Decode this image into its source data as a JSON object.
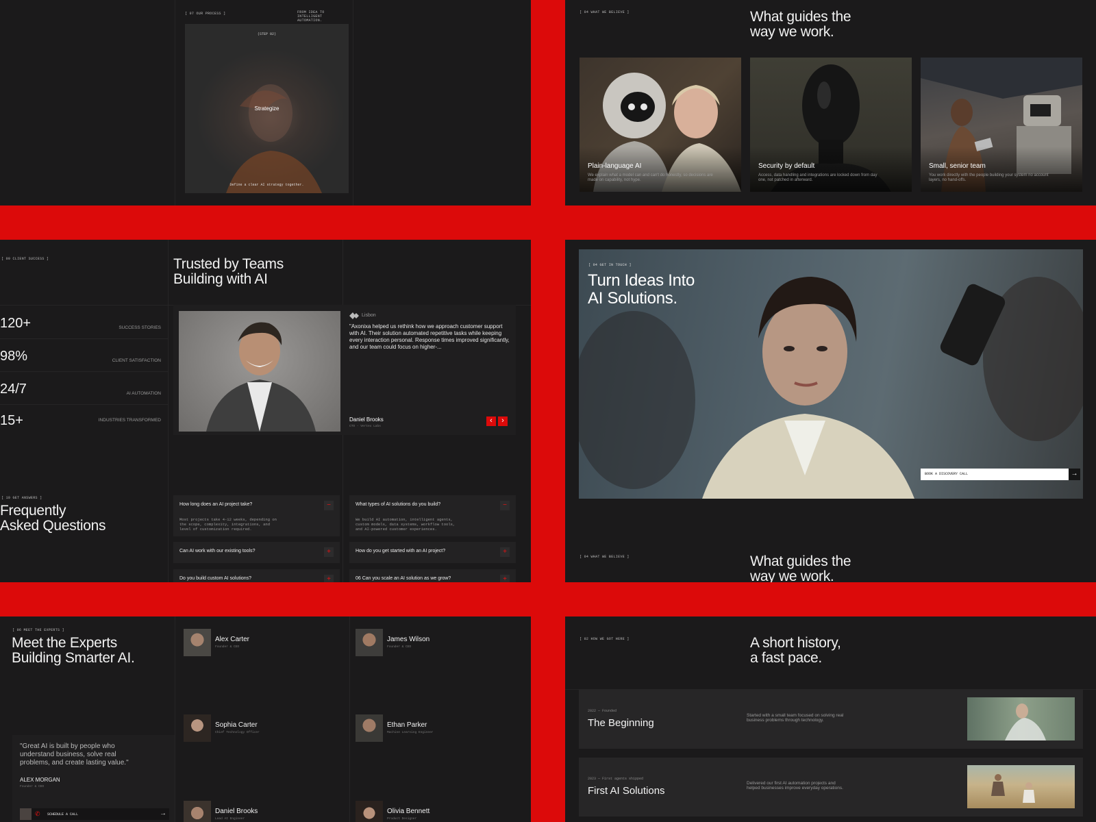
{
  "process": {
    "tag": "[ 07 OUR PROCESS ]",
    "subtitle": "FROM IDEA TO INTELLIGENT AUTOMATION.",
    "step": "(STEP 02)",
    "title": "Strategize",
    "caption": "Define a clear AI strategy together."
  },
  "beliefs_top": {
    "tag": "[ 04 WHAT WE BELIEVE ]",
    "title_line1": "What guides the",
    "title_line2": "way we work.",
    "cards": [
      {
        "title": "Plain-language AI",
        "desc": "We explain what a model can and can't do honestly, so decisions are made on capability, not hype."
      },
      {
        "title": "Security by default",
        "desc": "Access, data handling and integrations are locked down from day one, not patched in afterward."
      },
      {
        "title": "Small, senior team",
        "desc": "You work directly with the people building your system no account layers, no hand-offs."
      }
    ]
  },
  "client_success": {
    "tag": "[ 09 CLIENT SUCCESS ]",
    "title_line1": "Trusted by Teams",
    "title_line2": "Building with AI",
    "stats": [
      {
        "value": "120+",
        "label": "SUCCESS STORIES"
      },
      {
        "value": "98%",
        "label": "CLIENT SATISFACTION"
      },
      {
        "value": "24/7",
        "label": "AI AUTOMATION"
      },
      {
        "value": "15+",
        "label": "INDUSTRIES TRANSFORMED"
      }
    ],
    "testimonial": {
      "company": "Lisbon",
      "quote": "\"Axonixa helped us rethink how we approach customer support with AI. Their solution automated repetitive tasks while keeping every interaction personal. Response times improved significantly, and our team could focus on higher-...",
      "name": "Daniel Brooks",
      "role": "CTO - Vertex Labs",
      "prev": "‹",
      "next": "›"
    }
  },
  "faq": {
    "tag": "[ 10 GET ANSWERS ]",
    "title_line1": "Frequently",
    "title_line2": "Asked Questions",
    "items": [
      {
        "q": "How long does an AI project take?",
        "a": "Most projects take 4-12 weeks, depending on the scope, complexity, integrations, and level of customization required.",
        "toggle": "−"
      },
      {
        "q": "What types of AI solutions do you build?",
        "a": "We build AI automation, intelligent agents, custom models, data systems, workflow tools, and AI-powered customer experiences.",
        "toggle": "−"
      },
      {
        "q": "Can AI work with our existing tools?",
        "a": "",
        "toggle": "+"
      },
      {
        "q": "How do you get started with an AI project?",
        "a": "",
        "toggle": "+"
      },
      {
        "q": "Do you build custom AI solutions?",
        "a": "",
        "toggle": "+"
      },
      {
        "q": "06 Can you scale an AI solution as we grow?",
        "a": "",
        "toggle": "+"
      }
    ]
  },
  "contact": {
    "tag": "[ 04 GET IN TOUCH ]",
    "title_line1": "Turn Ideas Into",
    "title_line2": "AI Solutions.",
    "cta": "BOOK A DISCOVERY CALL",
    "cta_arrow": "→"
  },
  "beliefs_bottom": {
    "tag": "[ 04 WHAT WE BELIEVE ]",
    "title_line1": "What guides the",
    "title_line2": "way we work."
  },
  "experts": {
    "tag": "[ 06 MEET THE EXPERTS ]",
    "title_line1": "Meet the Experts",
    "title_line2": "Building Smarter AI.",
    "quote": "\"Great AI is built by people who understand business, solve real problems, and create lasting value.\"",
    "author": "ALEX MORGAN",
    "author_role": "Founder & CEO",
    "cta": "SCHEDULE A CALL",
    "cta_arrow": "→",
    "members": [
      {
        "name": "Alex Carter",
        "role": "Founder & CEO"
      },
      {
        "name": "James Wilson",
        "role": "Founder & CEO"
      },
      {
        "name": "Sophia Carter",
        "role": "Chief Technology Officer"
      },
      {
        "name": "Ethan Parker",
        "role": "Machine Learning Engineer"
      },
      {
        "name": "Daniel Brooks",
        "role": "Lead AI Engineer"
      },
      {
        "name": "Olivia Bennett",
        "role": "Product Designer"
      }
    ]
  },
  "history": {
    "tag": "[ 02 HOW WE GOT HERE ]",
    "title_line1": "A short history,",
    "title_line2": "a fast pace.",
    "items": [
      {
        "year": "2022 — Founded",
        "title": "The Beginning",
        "desc": "Started with a small team focused on solving real business problems through technology."
      },
      {
        "year": "2023 — First agents shipped",
        "title": "First AI Solutions",
        "desc": "Delivered our first AI automation projects and helped businesses improve everyday operations."
      }
    ]
  },
  "colors": {
    "accent": "#dc0a0a",
    "panel": "#1b1a1b",
    "card": "#232223"
  }
}
